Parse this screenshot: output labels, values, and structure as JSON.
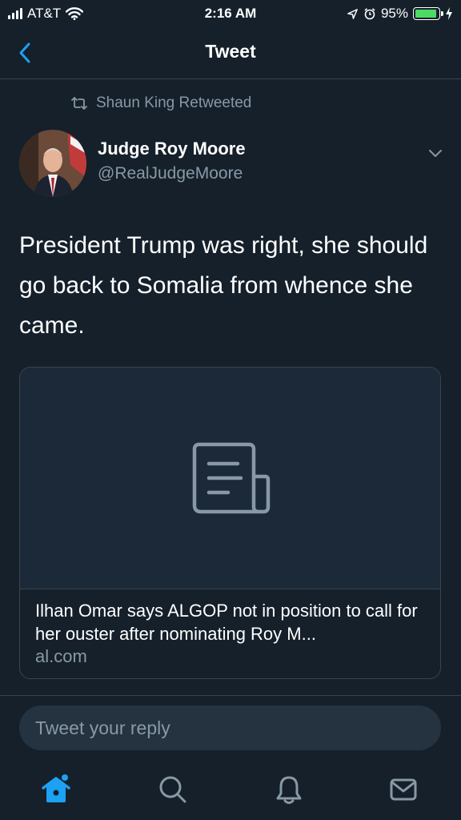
{
  "status_bar": {
    "carrier": "AT&T",
    "time": "2:16 AM",
    "battery_percent": "95%",
    "battery_level": 0.95
  },
  "nav": {
    "title": "Tweet",
    "back_icon": "chevron-left-icon"
  },
  "tweet": {
    "retweeted_by": "Shaun King Retweeted",
    "author_name": "Judge Roy Moore",
    "author_handle": "@RealJudgeMoore",
    "text": "President Trump was right, she should go back to Somalia from whence she came."
  },
  "link_card": {
    "title": "Ilhan Omar says ALGOP not in position to call for her ouster after nominating Roy M...",
    "domain": "al.com",
    "placeholder_icon": "document-icon"
  },
  "reply": {
    "placeholder": "Tweet your reply"
  },
  "tabbar": {
    "items": [
      "home-icon",
      "search-icon",
      "notifications-icon",
      "messages-icon"
    ],
    "active": "home-icon"
  },
  "colors": {
    "background": "#15202b",
    "accent": "#1da1f2",
    "secondary_text": "#8899a6",
    "border": "#38444d",
    "battery": "#4cd964"
  }
}
